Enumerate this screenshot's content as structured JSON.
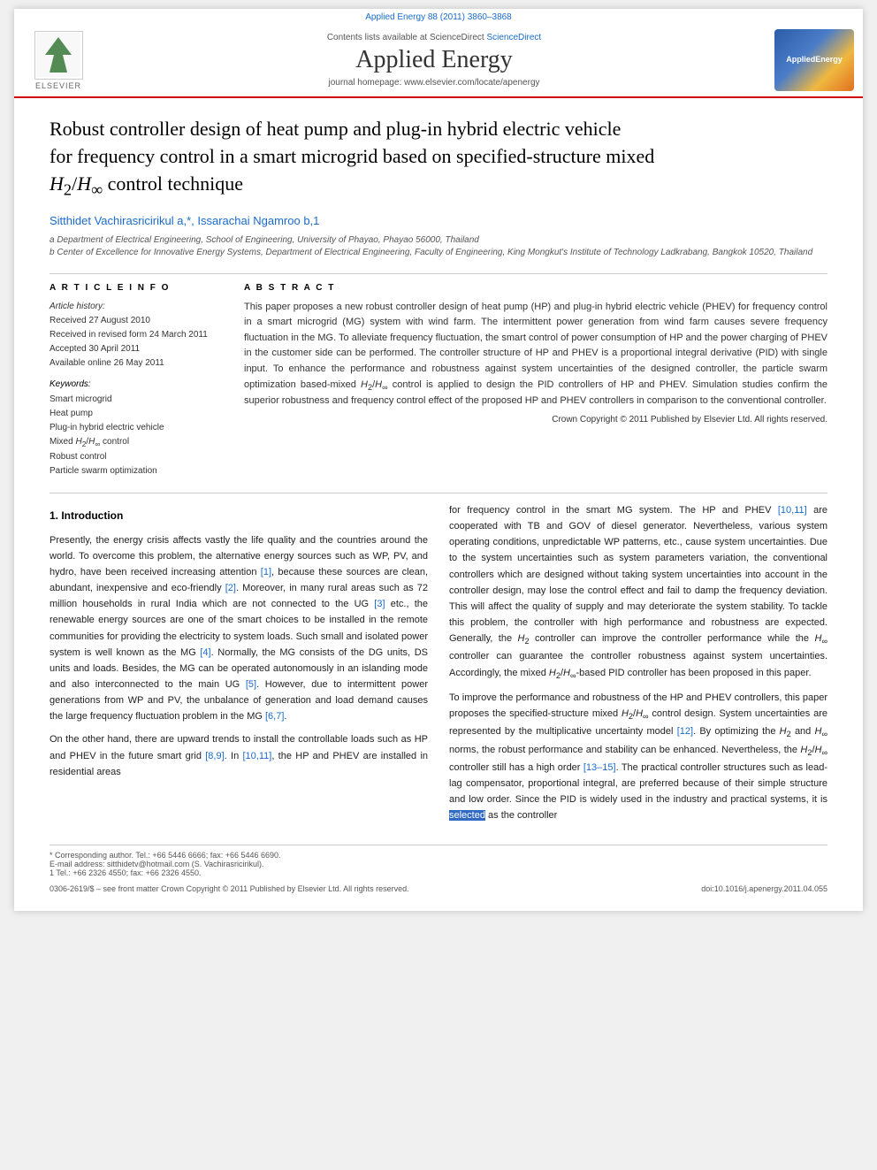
{
  "journal": {
    "top_info": "Applied Energy 88 (2011) 3860–3868",
    "contents_line": "Contents lists available at ScienceDirect",
    "sciencedirect_link": "ScienceDirect",
    "main_title": "Applied Energy",
    "homepage_line": "journal homepage: www.elsevier.com/locate/apenergy",
    "logo_text": "AppliedEnergy",
    "elsevier_label": "ELSEVIER"
  },
  "article": {
    "title_line1": "Robust controller design of heat pump and plug-in hybrid electric vehicle",
    "title_line2": "for frequency control in a smart microgrid based on specified-structure mixed",
    "title_line3": "H",
    "title_line3_sub": "2",
    "title_line3_mid": "/H",
    "title_line3_sub2": "∞",
    "title_line3_end": " control technique",
    "authors": "Sitthidet Vachirasricirikul a,*, Issarachai Ngamroo b,1",
    "affiliation_a": "a Department of Electrical Engineering, School of Engineering, University of Phayao, Phayao 56000, Thailand",
    "affiliation_b": "b Center of Excellence for Innovative Energy Systems, Department of Electrical Engineering, Faculty of Engineering, King Mongkut's Institute of Technology Ladkrabang, Bangkok 10520, Thailand"
  },
  "article_info": {
    "section_label": "A R T I C L E   I N F O",
    "history_label": "Article history:",
    "received": "Received 27 August 2010",
    "revised": "Received in revised form 24 March 2011",
    "accepted": "Accepted 30 April 2011",
    "available": "Available online 26 May 2011",
    "keywords_label": "Keywords:",
    "keywords": [
      "Smart microgrid",
      "Heat pump",
      "Plug-in hybrid electric vehicle",
      "Mixed H2/H∞ control",
      "Robust control",
      "Particle swarm optimization"
    ]
  },
  "abstract": {
    "section_label": "A B S T R A C T",
    "text": "This paper proposes a new robust controller design of heat pump (HP) and plug-in hybrid electric vehicle (PHEV) for frequency control in a smart microgrid (MG) system with wind farm. The intermittent power generation from wind farm causes severe frequency fluctuation in the MG. To alleviate frequency fluctuation, the smart control of power consumption of HP and the power charging of PHEV in the customer side can be performed. The controller structure of HP and PHEV is a proportional integral derivative (PID) with single input. To enhance the performance and robustness against system uncertainties of the designed controller, the particle swarm optimization based-mixed H2/H∞ control is applied to design the PID controllers of HP and PHEV. Simulation studies confirm the superior robustness and frequency control effect of the proposed HP and PHEV controllers in comparison to the conventional controller.",
    "copyright": "Crown Copyright © 2011 Published by Elsevier Ltd. All rights reserved."
  },
  "body": {
    "section1_heading": "1. Introduction",
    "left_col": [
      "Presently, the energy crisis affects vastly the life quality and the countries around the world. To overcome this problem, the alternative energy sources such as WP, PV, and hydro, have been received increasing attention [1], because these sources are clean, abundant, inexpensive and eco-friendly [2]. Moreover, in many rural areas such as 72 million households in rural India which are not connected to the UG [3] etc., the renewable energy sources are one of the smart choices to be installed in the remote communities for providing the electricity to system loads. Such small and isolated power system is well known as the MG [4]. Normally, the MG consists of the DG units, DS units and loads. Besides, the MG can be operated autonomously in an islanding mode and also interconnected to the main UG [5]. However, due to intermittent power generations from WP and PV, the unbalance of generation and load demand causes the large frequency fluctuation problem in the MG [6,7].",
      "On the other hand, there are upward trends to install the controllable loads such as HP and PHEV in the future smart grid [8,9]. In [10,11], the HP and PHEV are installed in residential areas"
    ],
    "right_col": [
      "for frequency control in the smart MG system. The HP and PHEV [10,11] are cooperated with TB and GOV of diesel generator. Nevertheless, various system operating conditions, unpredictable WP patterns, etc., cause system uncertainties. Due to the system uncertainties such as system parameters variation, the conventional controllers which are designed without taking system uncertainties into account in the controller design, may lose the control effect and fail to damp the frequency deviation. This will affect the quality of supply and may deteriorate the system stability. To tackle this problem, the controller with high performance and robustness are expected. Generally, the H2 controller can improve the controller performance while the H∞ controller can guarantee the controller robustness against system uncertainties. Accordingly, the mixed H2/H∞-based PID controller has been proposed in this paper.",
      "To improve the performance and robustness of the HP and PHEV controllers, this paper proposes the specified-structure mixed H2/H∞ control design. System uncertainties are represented by the multiplicative uncertainty model [12]. By optimizing the H2 and H∞ norms, the robust performance and stability can be enhanced. Nevertheless, the H2/H∞ controller still has a high order [13–15]. The practical controller structures such as lead-lag compensator, proportional integral, are preferred because of their simple structure and low order. Since the PID is widely used in the industry and practical systems, it is selected as the controller"
    ]
  },
  "footnotes": {
    "corresponding": "* Corresponding author. Tel.: +66 5446 6666; fax: +66 5446 6690.",
    "email": "E-mail address: sitthidetv@hotmail.com (S. Vachirasricirikul).",
    "note1": "1 Tel.: +66 2326 4550; fax: +66 2326 4550."
  },
  "bottom_footer": {
    "left": "0306-2619/$ – see front matter Crown Copyright © 2011 Published by Elsevier Ltd. All rights reserved.",
    "doi": "doi:10.1016/j.apenergy.2011.04.055"
  },
  "selection": {
    "text": "selected"
  }
}
